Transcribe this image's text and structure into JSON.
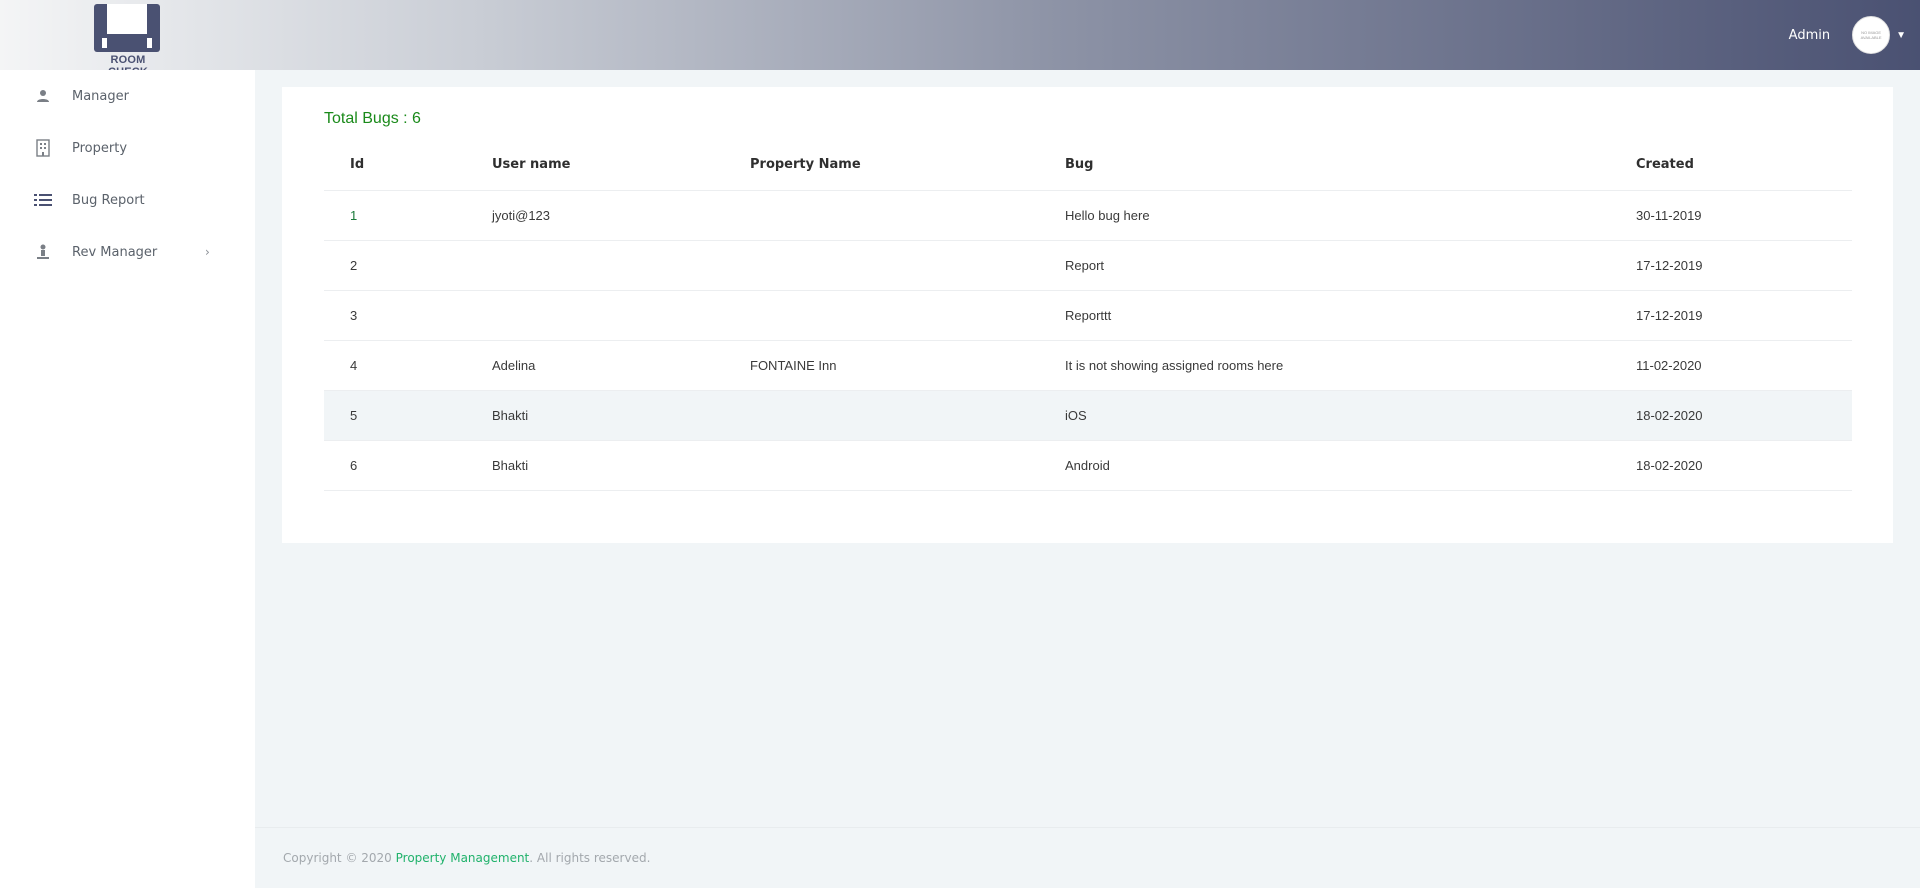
{
  "header": {
    "logo_text": "ROOM CHECK",
    "user_name": "Admin",
    "avatar_text": "NO IMAGE AVAILABLE"
  },
  "sidebar": {
    "items": [
      {
        "label": "Manager",
        "icon": "person-icon"
      },
      {
        "label": "Property",
        "icon": "building-icon"
      },
      {
        "label": "Bug Report",
        "icon": "list-icon"
      },
      {
        "label": "Rev Manager",
        "icon": "person-stand-icon",
        "has_submenu": true
      }
    ]
  },
  "main": {
    "total_label": "Total Bugs : 6",
    "table": {
      "columns": [
        "Id",
        "User name",
        "Property Name",
        "Bug",
        "Created"
      ],
      "rows": [
        [
          "1",
          "jyoti@123",
          "",
          "Hello bug here",
          "30-11-2019"
        ],
        [
          "2",
          "",
          "",
          "Report",
          "17-12-2019"
        ],
        [
          "3",
          "",
          "",
          "Reporttt",
          "17-12-2019"
        ],
        [
          "4",
          "Adelina",
          "FONTAINE Inn",
          "It is not showing assigned rooms here",
          "11-02-2020"
        ],
        [
          "5",
          "Bhakti",
          "",
          "iOS",
          "18-02-2020"
        ],
        [
          "6",
          "Bhakti",
          "",
          "Android",
          "18-02-2020"
        ]
      ]
    }
  },
  "footer": {
    "prefix": "Copyright © 2020 ",
    "brand": "Property Management",
    "suffix": ". All rights reserved."
  },
  "colors": {
    "accent_green": "#1a8a1a",
    "brand_green": "#20b26b",
    "header_dark": "#4a5172"
  }
}
